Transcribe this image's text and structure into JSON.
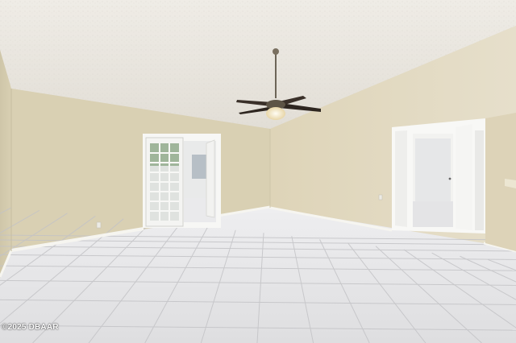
{
  "watermark": {
    "text": "©2025 DBAAR"
  },
  "scene": {
    "description_tags": [
      "ceiling-fan",
      "french-doors",
      "open-doorway",
      "tile-floor",
      "vaulted-ceiling"
    ],
    "colors": {
      "ceiling": "#ece9e3",
      "wall_left": "#d8cfb2",
      "wall_back": "#ddd3b6",
      "wall_right": "#e2dac2",
      "baseboard": "#f4f2ec",
      "floor": "#e9e9ea",
      "grout": "#bfbfc1",
      "door_frame": "#f7f7f5",
      "fan_metal": "#6d6558",
      "fan_blade": "#2e2620",
      "fan_light": "#f3e7c8"
    }
  }
}
